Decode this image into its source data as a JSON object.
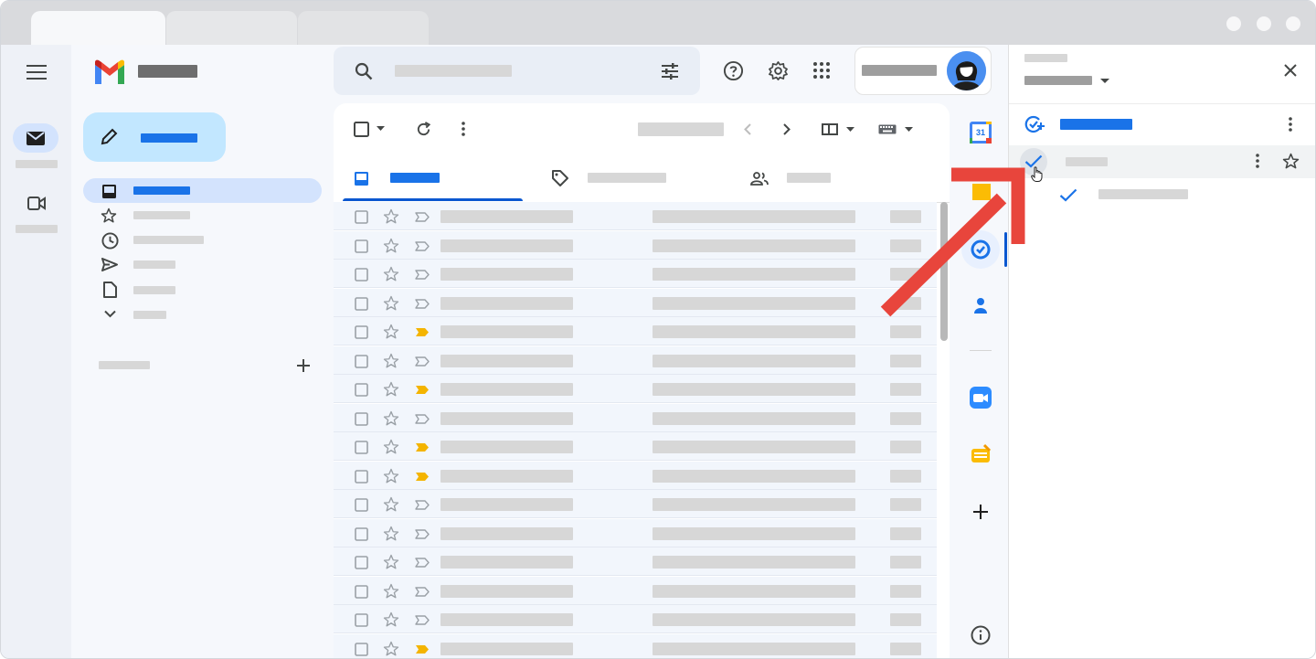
{
  "browser": {
    "tabs": [
      {
        "label": ""
      },
      {
        "label": ""
      },
      {
        "label": ""
      }
    ],
    "window_controls": [
      "minimize-dot",
      "maximize-dot",
      "close-dot"
    ]
  },
  "gmail": {
    "brand_colors": {
      "red": "#ea4335",
      "blue": "#4285f4",
      "green": "#34a853",
      "yellow": "#fbbc04"
    },
    "accent": "#1a73e8",
    "compose_bg": "#c2e7ff",
    "nav_selected_bg": "#d3e3fd",
    "rail_items": [
      {
        "icon": "mail-icon"
      },
      {
        "icon": "video-icon"
      }
    ],
    "nav_items": [
      {
        "icon": "inbox-icon",
        "selected": true
      },
      {
        "icon": "star-icon"
      },
      {
        "icon": "clock-icon"
      },
      {
        "icon": "send-icon"
      },
      {
        "icon": "file-icon"
      },
      {
        "icon": "chevron-down-icon"
      }
    ],
    "labels_section": {
      "add_icon": "plus-icon"
    },
    "header_icons": [
      "search-icon",
      "tune-icon",
      "help-icon",
      "settings-icon",
      "apps-icon",
      "avatar"
    ],
    "toolbar_icons": [
      "checkbox-icon",
      "refresh-icon",
      "more-vert-icon",
      "chevron-left-icon",
      "chevron-right-icon",
      "split-pane-icon",
      "keyboard-icon"
    ],
    "tabs": [
      {
        "icon": "inbox-icon",
        "active": true
      },
      {
        "icon": "tag-icon"
      },
      {
        "icon": "people-icon"
      }
    ],
    "email_rows": [
      {
        "important": false
      },
      {
        "important": false
      },
      {
        "important": false
      },
      {
        "important": false
      },
      {
        "important": true
      },
      {
        "important": false
      },
      {
        "important": true
      },
      {
        "important": false
      },
      {
        "important": true
      },
      {
        "important": true
      },
      {
        "important": false
      },
      {
        "important": false
      },
      {
        "important": false
      },
      {
        "important": false
      },
      {
        "important": false
      },
      {
        "important": true
      }
    ],
    "side_apps": [
      "calendar-icon",
      "keep-icon",
      "tasks-icon",
      "contacts-icon",
      "zoom-icon",
      "app-icon",
      "plus-icon",
      "info-icon"
    ],
    "calendar_day": "31"
  },
  "tasks_panel": {
    "header_icons": [
      "dropdown-icon",
      "close-icon"
    ],
    "add_task_icon": "add-task-icon",
    "task_icons": [
      "check-icon",
      "more-vert-icon",
      "star-icon"
    ],
    "subtask_icon": "check-icon",
    "annotation_arrow_color": "#e8453c"
  }
}
